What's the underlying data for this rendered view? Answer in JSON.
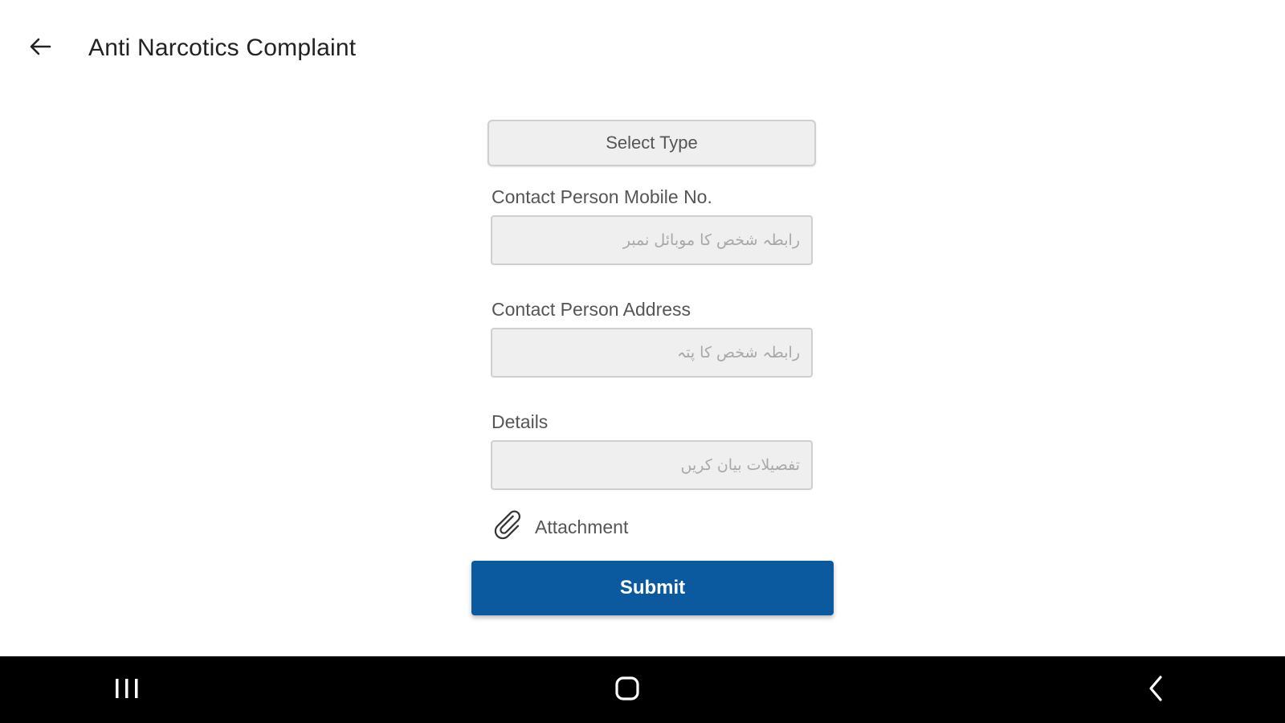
{
  "app_bar": {
    "title": "Anti Narcotics Complaint",
    "back_icon": "arrow-left-icon"
  },
  "form": {
    "select_type_label": "Select Type",
    "fields": [
      {
        "label": "Contact Person Mobile No.",
        "placeholder": "رابطہ شخص کا موبائل نمبر",
        "value": ""
      },
      {
        "label": "Contact Person Address",
        "placeholder": "رابطہ شخص کا پتہ",
        "value": ""
      },
      {
        "label": "Details",
        "placeholder": "تفصیلات بیان کریں",
        "value": ""
      }
    ],
    "attachment": {
      "icon": "paperclip-icon",
      "label": "Attachment"
    },
    "submit_label": "Submit"
  },
  "nav_bar": {
    "items": [
      "recent-apps-icon",
      "home-icon",
      "back-chevron-icon"
    ]
  },
  "colors": {
    "primary": "#0b5aa0",
    "field_background": "#efefef",
    "field_border": "#cfcfcf",
    "nav_background": "#000000"
  }
}
